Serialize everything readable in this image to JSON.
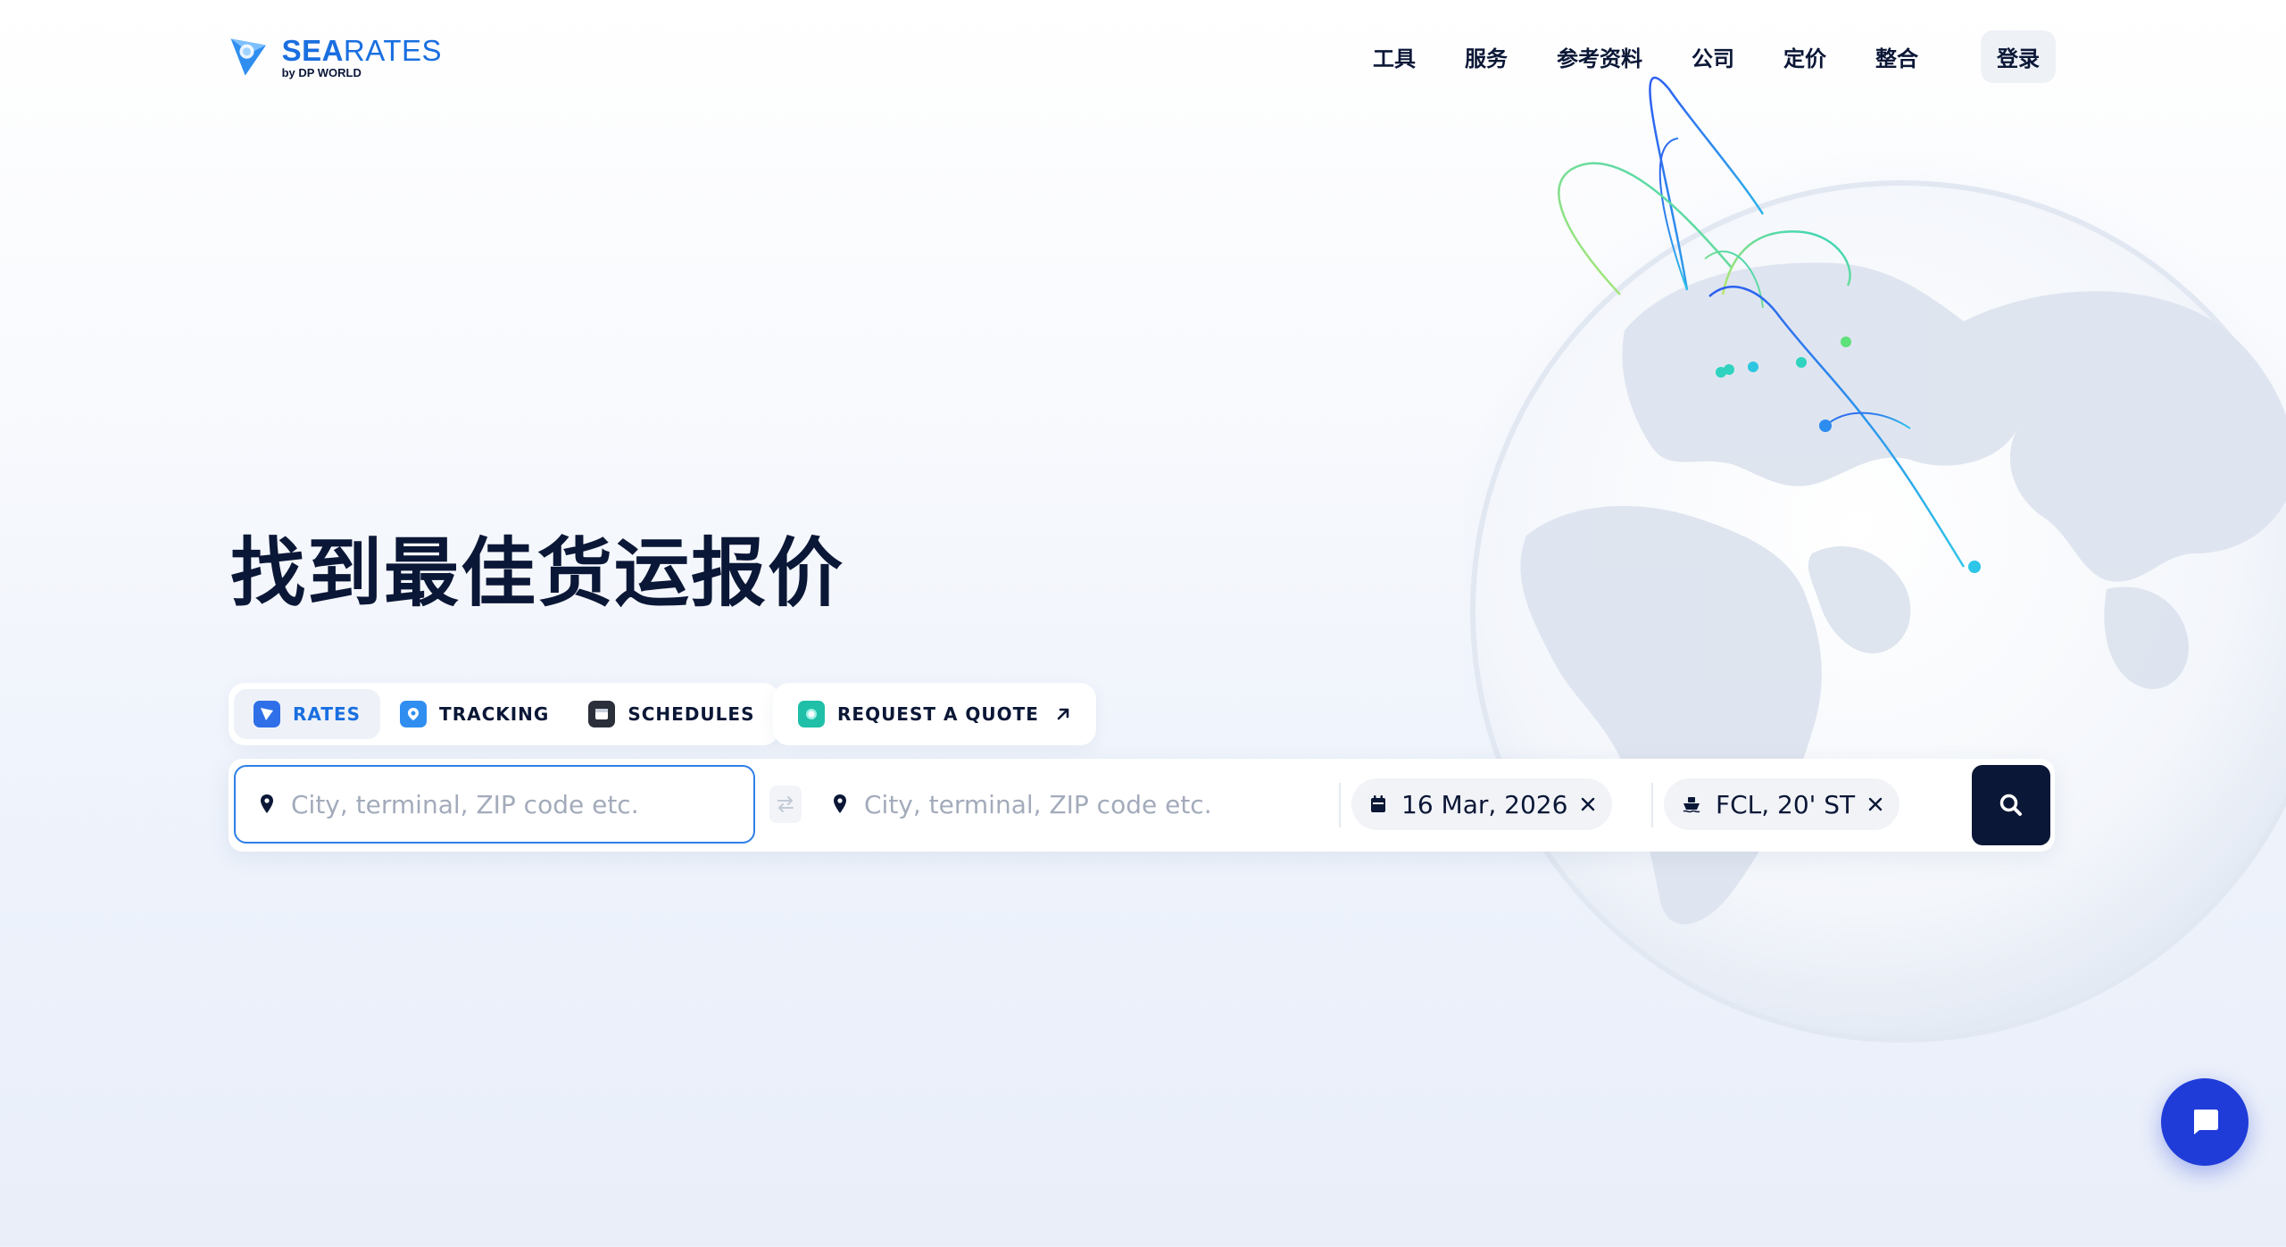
{
  "header": {
    "logo_brand_strong": "SEA",
    "logo_brand_light": "RATES",
    "logo_sub": "by DP WORLD",
    "nav": [
      "工具",
      "服务",
      "参考资料",
      "公司",
      "定价",
      "整合"
    ],
    "login": "登录"
  },
  "hero": {
    "title": "找到最佳货运报价"
  },
  "tabs": [
    {
      "label": "RATES",
      "icon": "rates-icon"
    },
    {
      "label": "TRACKING",
      "icon": "tracking-icon"
    },
    {
      "label": "SCHEDULES",
      "icon": "schedules-icon"
    }
  ],
  "quote": {
    "label": "REQUEST A QUOTE",
    "icon": "arrow-up-right-icon"
  },
  "search": {
    "origin_placeholder": "City, terminal, ZIP code etc.",
    "destination_placeholder": "City, terminal, ZIP code etc.",
    "date": "16 Mar, 2026",
    "container": "FCL, 20' ST"
  },
  "colors": {
    "brand_blue": "#1a6fe0",
    "navy": "#0b1736",
    "chat_blue": "#1f3cd9",
    "route_teal": "#2fd3c0",
    "route_blue": "#2d8cf0"
  }
}
